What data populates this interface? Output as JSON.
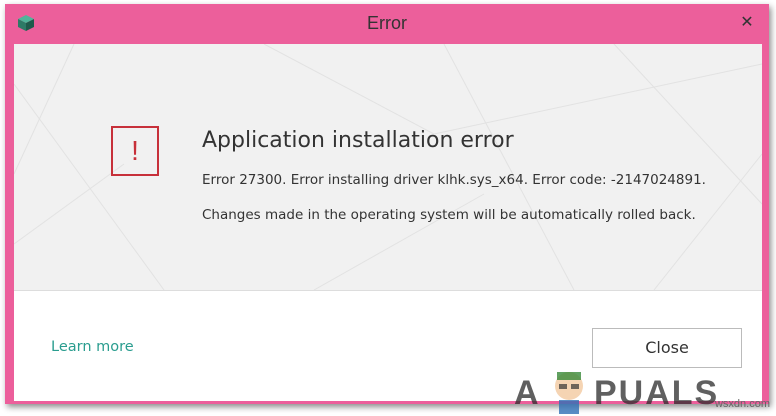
{
  "window": {
    "title": "Error",
    "close_glyph": "✕",
    "app_icon": "kaspersky-cube-icon",
    "titlebar_color": "#ec5f9b"
  },
  "dialog": {
    "warning_glyph": "!",
    "warning_icon": "exclamation-icon",
    "warning_color": "#c7303a",
    "heading": "Application installation error",
    "message_line1": "Error 27300. Error installing driver klhk.sys_x64. Error code: -2147024891.",
    "message_line2": "Changes made in the operating system will be automatically rolled back."
  },
  "footer": {
    "learn_more_label": "Learn more",
    "close_label": "Close",
    "link_color": "#2a9d8f"
  },
  "watermark": {
    "logo_left": "A",
    "logo_right": "PUALS",
    "site": "wsxdn.com"
  }
}
